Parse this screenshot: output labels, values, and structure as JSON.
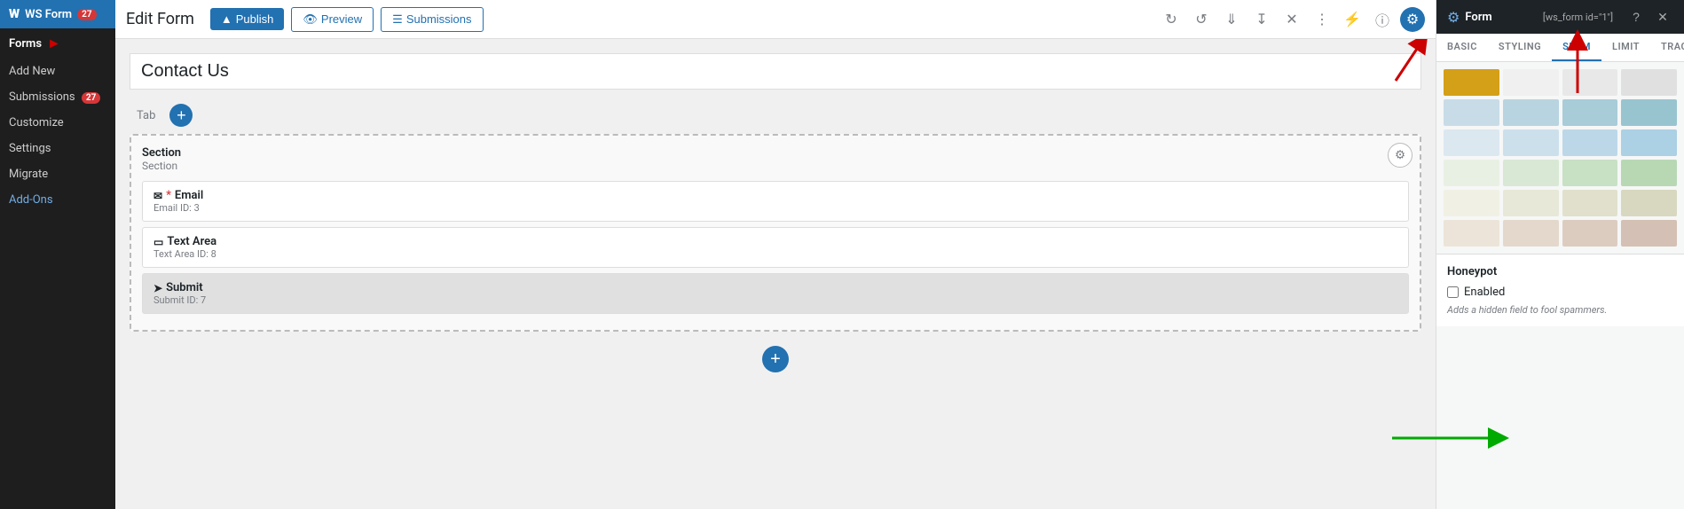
{
  "sidebar": {
    "brand_label": "WS Form",
    "brand_badge": "27",
    "items": [
      {
        "id": "forms",
        "label": "Forms",
        "active": true,
        "has_arrow": true
      },
      {
        "id": "add-new",
        "label": "Add New",
        "active": false
      },
      {
        "id": "submissions",
        "label": "Submissions",
        "badge": "27"
      },
      {
        "id": "customize",
        "label": "Customize"
      },
      {
        "id": "settings",
        "label": "Settings"
      },
      {
        "id": "migrate",
        "label": "Migrate"
      },
      {
        "id": "add-ons",
        "label": "Add-Ons",
        "blue": true
      }
    ]
  },
  "toolbar": {
    "page_title": "Edit Form",
    "publish_label": "Publish",
    "preview_label": "Preview",
    "submissions_label": "Submissions",
    "icons": [
      "undo",
      "redo",
      "save",
      "download",
      "close",
      "layers",
      "bolt",
      "help",
      "settings"
    ]
  },
  "form_editor": {
    "form_title": "Contact Us",
    "tab_label": "Tab",
    "section": {
      "name": "Section",
      "sub": "Section"
    },
    "fields": [
      {
        "id": 1,
        "icon": "email",
        "label": "Email",
        "required": true,
        "field_id": "Email  ID: 3",
        "type": "email"
      },
      {
        "id": 2,
        "icon": "textarea",
        "label": "Text Area",
        "required": false,
        "field_id": "Text Area  ID: 8",
        "type": "textarea"
      },
      {
        "id": 3,
        "icon": "submit",
        "label": "Submit",
        "required": false,
        "field_id": "Submit  ID: 7",
        "type": "submit"
      }
    ]
  },
  "right_panel": {
    "header": {
      "title": "Form",
      "shortcode": "[ws_form id=\"1\"]",
      "gear_icon": "gear"
    },
    "tabs": [
      {
        "id": "basic",
        "label": "BASIC"
      },
      {
        "id": "styling",
        "label": "STYLING"
      },
      {
        "id": "spam",
        "label": "SPAM",
        "active": true
      },
      {
        "id": "limit",
        "label": "LIMIT"
      },
      {
        "id": "tracking",
        "label": "TRACKING"
      }
    ],
    "swatches": [
      "#d4a017",
      "#f5f5f5",
      "#e8e8e8",
      "#d0d0d0",
      "#b8d4e8",
      "#a0c4e0",
      "#88b4d8",
      "#70a4cc",
      "#c8dce8",
      "#b0cce0",
      "#98bcd8",
      "#80accc",
      "#e8f0e8",
      "#d0e8d0",
      "#b8d8b8",
      "#a0c8a0",
      "#f0f0e8",
      "#e8e8d8",
      "#e0e0c8",
      "#d8d8b8",
      "#e8e0d0",
      "#e0d8c8",
      "#d8d0c0",
      "#d0c8b8"
    ],
    "honeypot": {
      "title": "Honeypot",
      "enabled_label": "Enabled",
      "description": "Adds a hidden field to fool spammers."
    }
  }
}
